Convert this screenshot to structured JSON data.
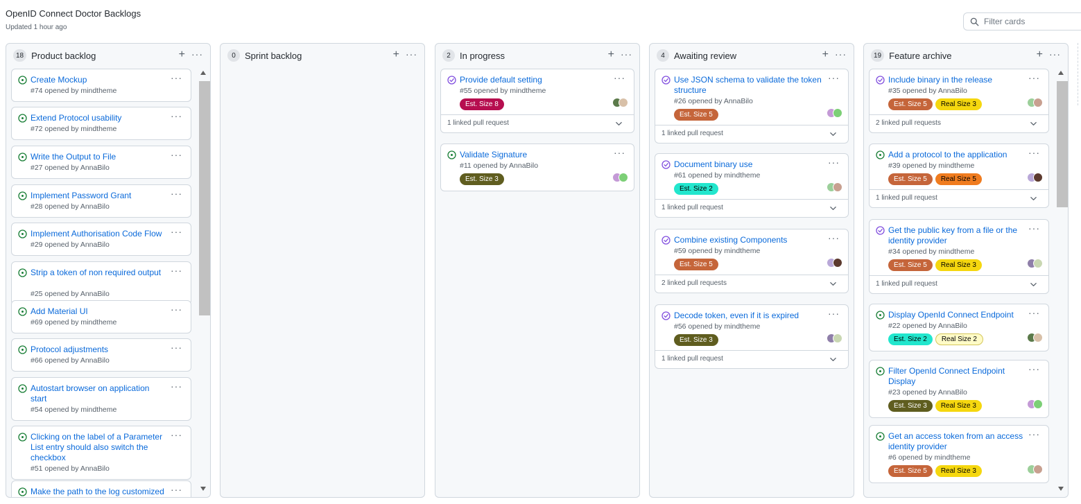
{
  "project": {
    "title": "OpenID Connect Doctor Backlogs",
    "updated": "Updated 1 hour ago"
  },
  "filter": {
    "placeholder": "Filter cards"
  },
  "colors": {
    "link": "#0969da",
    "open_icon": "#1a7f37",
    "closed_icon": "#8250df",
    "est8": "#b60e4f",
    "est5": "#c5653a",
    "est3": "#5f5d1f",
    "est2": "#22e6cd",
    "real5": "#f07c1f",
    "real3": "#f5d70f",
    "real2": "#fffbc7"
  },
  "columns": [
    {
      "count": "18",
      "name": "Product backlog",
      "cards": [
        {
          "title": "Create Mockup",
          "sub": "#74 opened by mindtheme",
          "state": "open"
        },
        {
          "title": "Extend Protocol usability",
          "sub": "#72 opened by mindtheme",
          "state": "open"
        },
        {
          "title": "Write the Output to File",
          "sub": "#27 opened by AnnaBilo",
          "state": "open"
        },
        {
          "title": "Implement Password Grant",
          "sub": "#28 opened by AnnaBilo",
          "state": "open"
        },
        {
          "title": "Implement Authorisation Code Flow",
          "sub": "#29 opened by AnnaBilo",
          "state": "open"
        },
        {
          "title": "Strip a token of non required output",
          "sub": "#25 opened by AnnaBilo",
          "state": "open"
        },
        {
          "title": "Add Material UI",
          "sub": "#69 opened by mindtheme",
          "state": "open"
        },
        {
          "title": "Protocol adjustments",
          "sub": "#66 opened by AnnaBilo",
          "state": "open"
        },
        {
          "title": "Autostart browser on application start",
          "sub": "#54 opened by mindtheme",
          "state": "open"
        },
        {
          "title": "Clicking on the label of a Parameter List entry should also switch the checkbox",
          "sub": "#51 opened by AnnaBilo",
          "state": "open"
        },
        {
          "title": "Make the path to the log customized",
          "sub": "",
          "state": "open"
        }
      ]
    },
    {
      "count": "0",
      "name": "Sprint backlog",
      "cards": []
    },
    {
      "count": "2",
      "name": "In progress",
      "cards": [
        {
          "title": "Provide default setting",
          "sub": "#55 opened by mindtheme",
          "state": "closed",
          "labels": [
            {
              "text": "Est. Size 8",
              "bg": "#b60e4f",
              "fg": "#ffffff"
            }
          ],
          "pr": "1 linked pull request"
        },
        {
          "title": "Validate Signature",
          "sub": "#11 opened by AnnaBilo",
          "state": "open",
          "labels": [
            {
              "text": "Est. Size 3",
              "bg": "#5f5d1f",
              "fg": "#ffffff"
            }
          ]
        }
      ]
    },
    {
      "count": "4",
      "name": "Awaiting review",
      "cards": [
        {
          "title": "Use JSON schema to validate the token structure",
          "sub": "#26 opened by AnnaBilo",
          "state": "closed",
          "labels": [
            {
              "text": "Est. Size 5",
              "bg": "#c5653a",
              "fg": "#ffffff"
            }
          ],
          "pr": "1 linked pull request"
        },
        {
          "title": "Document binary use",
          "sub": "#61 opened by mindtheme",
          "state": "closed",
          "labels": [
            {
              "text": "Est. Size 2",
              "bg": "#22e6cd",
              "fg": "#000000"
            }
          ],
          "pr": "1 linked pull request"
        },
        {
          "title": "Combine existing Components",
          "sub": "#59 opened by mindtheme",
          "state": "closed",
          "labels": [
            {
              "text": "Est. Size 5",
              "bg": "#c5653a",
              "fg": "#ffffff"
            }
          ],
          "pr": "2 linked pull requests"
        },
        {
          "title": "Decode token, even if it is expired",
          "sub": "#56 opened by mindtheme",
          "state": "closed",
          "labels": [
            {
              "text": "Est. Size 3",
              "bg": "#5f5d1f",
              "fg": "#ffffff"
            }
          ],
          "pr": "1 linked pull request"
        }
      ]
    },
    {
      "count": "19",
      "name": "Feature archive",
      "cards": [
        {
          "title": "Include binary in the release",
          "sub": "#35 opened by AnnaBilo",
          "state": "closed",
          "labels": [
            {
              "text": "Est. Size 5",
              "bg": "#c5653a",
              "fg": "#ffffff"
            },
            {
              "text": "Real Size 3",
              "bg": "#f5d70f",
              "fg": "#000000"
            }
          ],
          "pr": "2 linked pull requests"
        },
        {
          "title": "Add a protocol to the application",
          "sub": "#39 opened by mindtheme",
          "state": "open",
          "labels": [
            {
              "text": "Est. Size 5",
              "bg": "#c5653a",
              "fg": "#ffffff"
            },
            {
              "text": "Real Size 5",
              "bg": "#f07c1f",
              "fg": "#000000"
            }
          ],
          "pr": "1 linked pull request"
        },
        {
          "title": "Get the public key from a file or the identity provider",
          "sub": "#34 opened by mindtheme",
          "state": "closed",
          "labels": [
            {
              "text": "Est. Size 5",
              "bg": "#c5653a",
              "fg": "#ffffff"
            },
            {
              "text": "Real Size 3",
              "bg": "#f5d70f",
              "fg": "#000000"
            }
          ],
          "pr": "1 linked pull request"
        },
        {
          "title": "Display OpenId Connect Endpoint",
          "sub": "#22 opened by AnnaBilo",
          "state": "open",
          "labels": [
            {
              "text": "Est. Size 2",
              "bg": "#22e6cd",
              "fg": "#000000"
            },
            {
              "text": "Real Size 2",
              "bg": "#fffbc7",
              "fg": "#000000"
            }
          ]
        },
        {
          "title": "Filter OpenId Connect Endpoint Display",
          "sub": "#23 opened by AnnaBilo",
          "state": "open",
          "labels": [
            {
              "text": "Est. Size 3",
              "bg": "#5f5d1f",
              "fg": "#ffffff"
            },
            {
              "text": "Real Size 3",
              "bg": "#f5d70f",
              "fg": "#000000"
            }
          ]
        },
        {
          "title": "Get an access token from an access identity provider",
          "sub": "#6 opened by mindtheme",
          "state": "open",
          "labels": [
            {
              "text": "Est. Size 5",
              "bg": "#c5653a",
              "fg": "#ffffff"
            },
            {
              "text": "Real Size 3",
              "bg": "#f5d70f",
              "fg": "#000000"
            }
          ]
        }
      ]
    }
  ]
}
